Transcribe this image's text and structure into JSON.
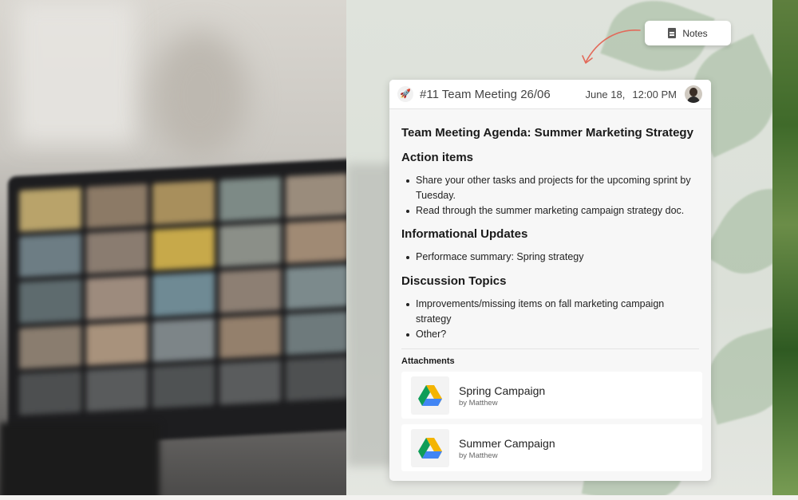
{
  "notes_button": {
    "label": "Notes",
    "icon": "document-icon"
  },
  "card": {
    "icon": "rocket-icon",
    "title": "#11 Team Meeting 26/06",
    "date": "June 18,",
    "time": "12:00 PM",
    "agenda_title": "Team Meeting Agenda: Summer Marketing Strategy",
    "sections": [
      {
        "heading": "Action items",
        "items": [
          "Share your other tasks and projects for the upcoming sprint by Tuesday.",
          "Read through the summer marketing campaign strategy doc."
        ]
      },
      {
        "heading": "Informational Updates",
        "items": [
          "Performace summary: Spring strategy"
        ]
      },
      {
        "heading": "Discussion Topics",
        "items": [
          "Improvements/missing items on fall marketing campaign strategy",
          "Other?"
        ]
      }
    ],
    "attachments_label": "Attachments",
    "attachments": [
      {
        "name": "Spring Campaign",
        "by": "by Matthew",
        "icon": "google-drive-icon"
      },
      {
        "name": "Summer Campaign",
        "by": "by Matthew",
        "icon": "google-drive-icon"
      }
    ]
  },
  "colors": {
    "arrow": "#e26a5a",
    "drive_green": "#0f9d58",
    "drive_yellow": "#f4b400",
    "drive_blue": "#4285f4"
  }
}
